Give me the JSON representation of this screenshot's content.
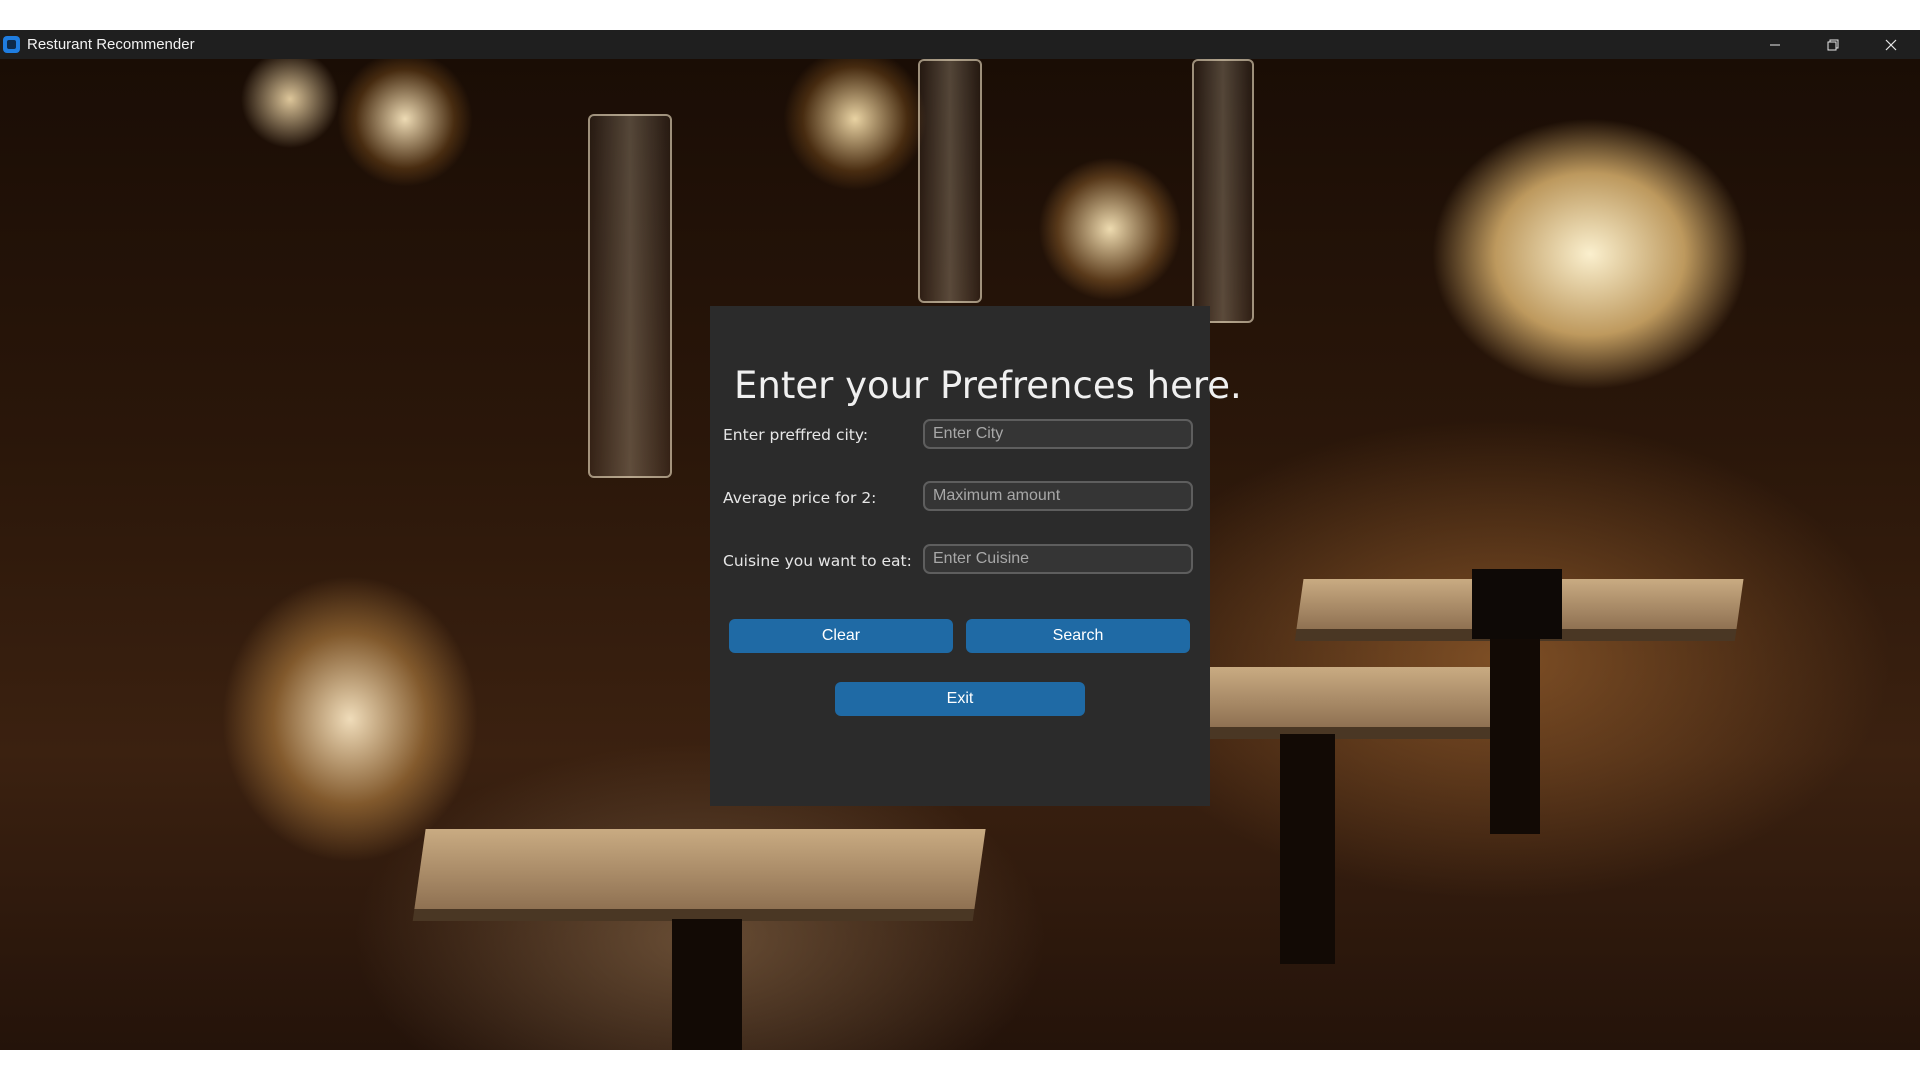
{
  "window": {
    "title": "Resturant Recommender",
    "controls": [
      "minimize-icon",
      "restore-icon",
      "close-icon"
    ]
  },
  "form": {
    "heading": "Enter your Prefrences here.",
    "fields": [
      {
        "label": "Enter preffred city:",
        "placeholder": "Enter City",
        "value": ""
      },
      {
        "label": "Average price for 2:",
        "placeholder": "Maximum amount",
        "value": ""
      },
      {
        "label": "Cuisine you want to eat:",
        "placeholder": "Enter Cuisine",
        "value": ""
      }
    ],
    "buttons": {
      "clear": "Clear",
      "search": "Search",
      "exit": "Exit"
    }
  },
  "colors": {
    "accent": "#1f6aa5",
    "panel": "#2b2b2b",
    "titlebar": "#1f1f1f",
    "app_icon": "#1f7de0"
  }
}
